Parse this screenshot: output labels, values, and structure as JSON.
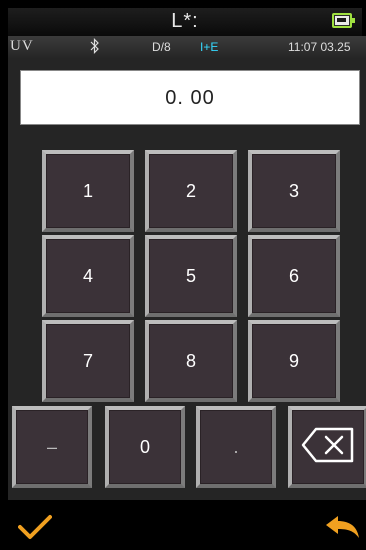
{
  "titlebar": {
    "title": "L*:"
  },
  "statusbar": {
    "uv_label": "UV",
    "geometry": "D/8",
    "mode": "I+E",
    "time": "11:07 03.25"
  },
  "display": {
    "value": "0. 00"
  },
  "keypad": {
    "k1": "1",
    "k2": "2",
    "k3": "3",
    "k4": "4",
    "k5": "5",
    "k6": "6",
    "k7": "7",
    "k8": "8",
    "k9": "9",
    "minus": "–",
    "zero": "0",
    "dot": "."
  },
  "icons": {
    "bluetooth": "bluetooth-icon",
    "battery": "battery-charging-icon",
    "backspace": "backspace-icon",
    "confirm": "checkmark-icon",
    "back": "back-arrow-icon"
  },
  "colors": {
    "accent_cyan": "#35d9ff",
    "battery_green": "#9fe040",
    "confirm_orange": "#f0a020",
    "key_face": "#3b3238"
  }
}
